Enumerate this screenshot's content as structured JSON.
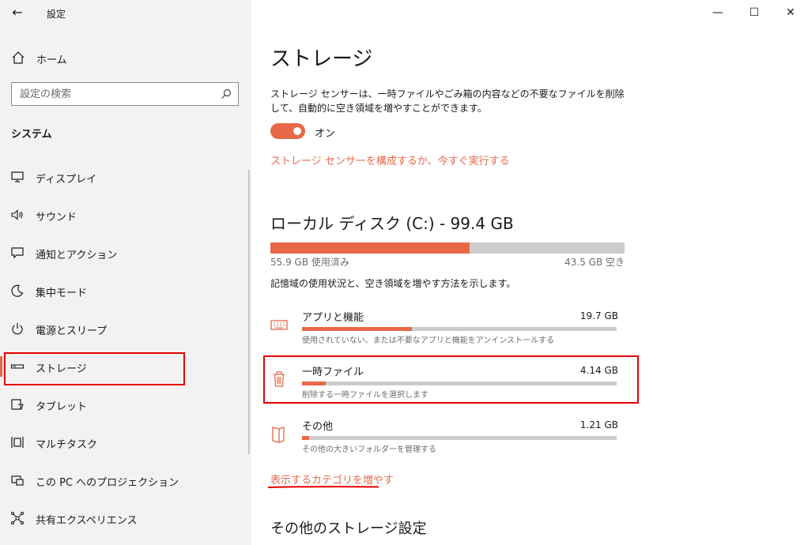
{
  "app_title": "設定",
  "window_controls": {
    "minimize": "—",
    "maximize": "☐",
    "close": "✕"
  },
  "sidebar": {
    "home_label": "ホーム",
    "search_placeholder": "設定の検索",
    "section_heading": "システム",
    "items": [
      {
        "label": "ディスプレイ",
        "icon": "display-icon"
      },
      {
        "label": "サウンド",
        "icon": "sound-icon"
      },
      {
        "label": "通知とアクション",
        "icon": "notification-icon"
      },
      {
        "label": "集中モード",
        "icon": "focus-moon-icon"
      },
      {
        "label": "電源とスリープ",
        "icon": "power-icon"
      },
      {
        "label": "ストレージ",
        "icon": "storage-icon",
        "active": true
      },
      {
        "label": "タブレット",
        "icon": "tablet-icon"
      },
      {
        "label": "マルチタスク",
        "icon": "multitask-icon"
      },
      {
        "label": "この PC へのプロジェクション",
        "icon": "projection-icon"
      },
      {
        "label": "共有エクスペリエンス",
        "icon": "shared-experience-icon"
      }
    ]
  },
  "main": {
    "title": "ストレージ",
    "sense_description": "ストレージ センサーは、一時ファイルやごみ箱の内容などの不要なファイルを削除して、自動的に空き領域を増やすことができます。",
    "toggle_state": "オン",
    "configure_link": "ストレージ センサーを構成するか、今すぐ実行する",
    "disk_title": "ローカル ディスク (C:) - 99.4 GB",
    "used_label": "55.9 GB 使用済み",
    "free_label": "43.5 GB 空き",
    "used_fraction": 0.562,
    "usage_description": "記憶域の使用状況と、空き領域を増やす方法を示します。",
    "categories": [
      {
        "name": "アプリと機能",
        "size": "19.7 GB",
        "sub": "使用されていない、または不要なアプリと機能をアンインストールする",
        "fraction": 0.35,
        "icon": "keyboard-icon"
      },
      {
        "name": "一時ファイル",
        "size": "4.14 GB",
        "sub": "削除する一時ファイルを選択します",
        "fraction": 0.075,
        "icon": "trash-icon"
      },
      {
        "name": "その他",
        "size": "1.21 GB",
        "sub": "その他の大きいフォルダーを管理する",
        "fraction": 0.022,
        "icon": "folder-icon"
      }
    ],
    "more_categories_link": "表示するカテゴリを増やす",
    "other_settings_heading": "その他のストレージ設定"
  },
  "colors": {
    "accent": "#e8684a",
    "highlight": "#e60000",
    "bar_bg": "#cccccc"
  }
}
